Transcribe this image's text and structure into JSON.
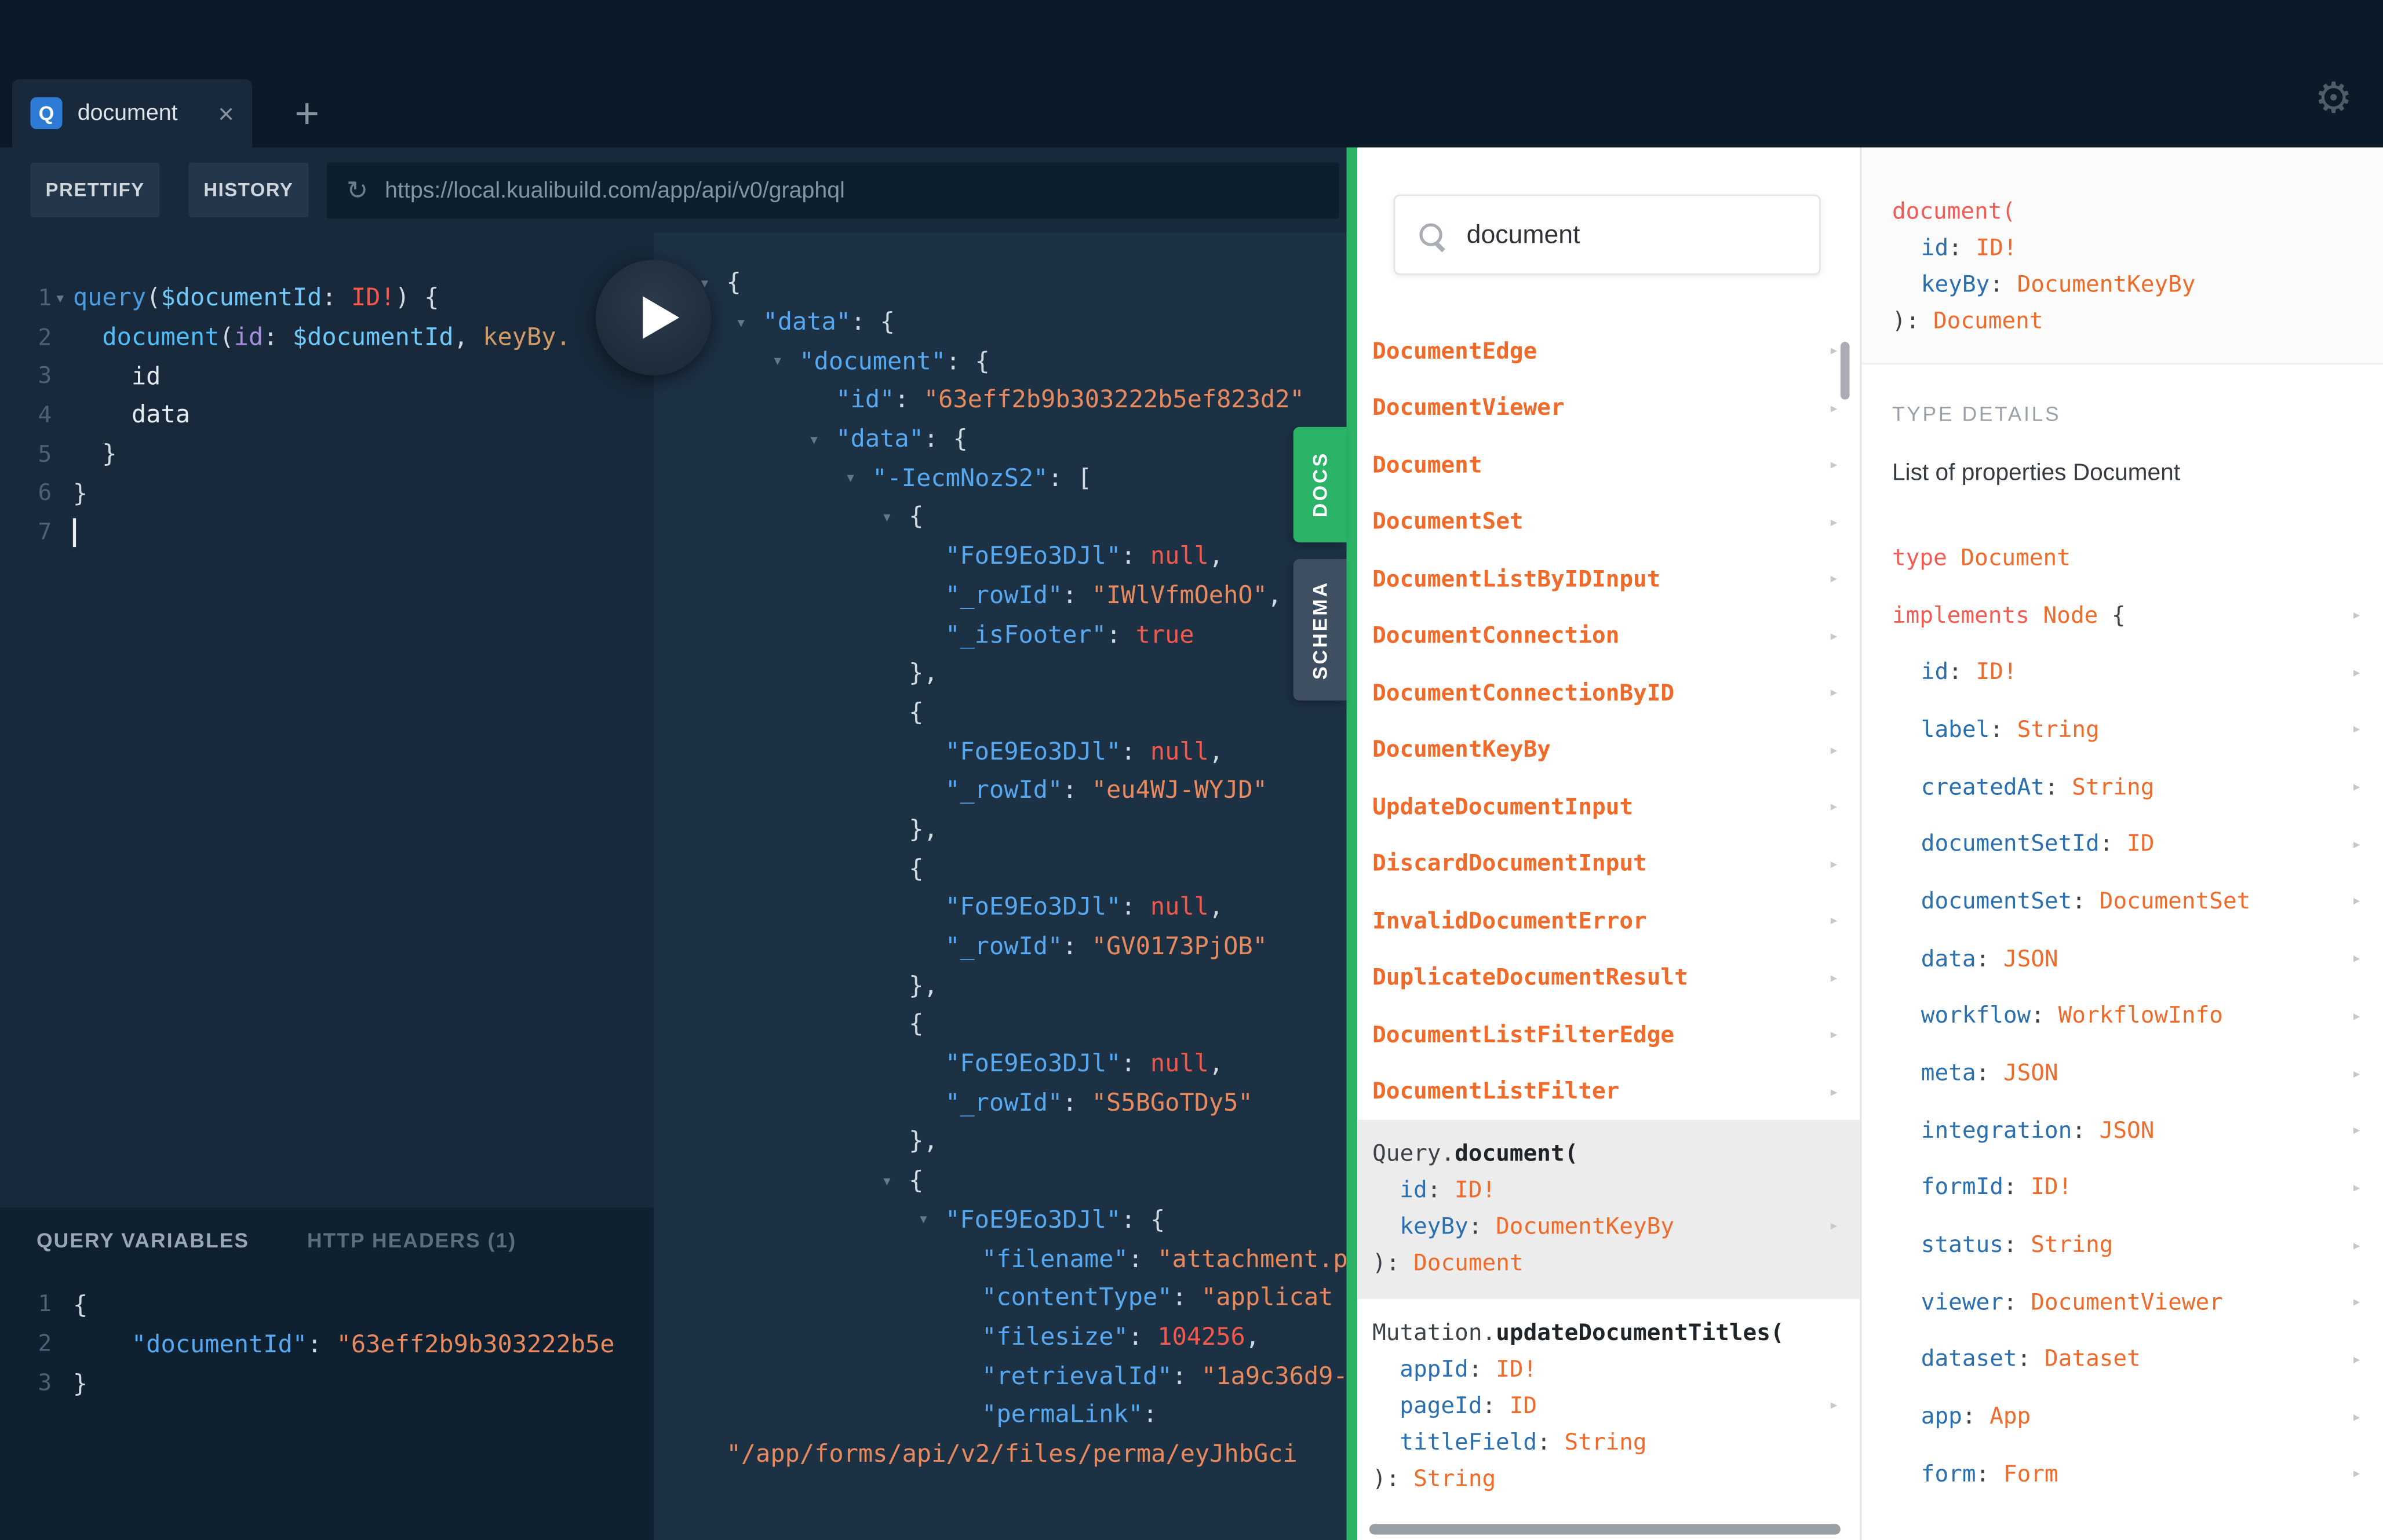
{
  "colors": {
    "header_bg": "#0b1a28",
    "panel_bg": "#17293a",
    "results_bg": "#1d3145",
    "variables_bg": "#0f2130",
    "accent_green": "#2bb368",
    "docs_orange": "#f06a2a",
    "docs_red": "#f25c54",
    "docs_blue": "#2a6fb0"
  },
  "icons": {
    "tab_badge": "Q",
    "close": "×",
    "plus": "+",
    "gear": "⚙",
    "reload": "↻",
    "fold_open": "▾",
    "chevron": "▸",
    "search": "magnifier-css-shape",
    "play": "triangle-css-shape"
  },
  "tab_bar": {
    "tab_title": "document"
  },
  "toolbar": {
    "prettify": "PRETTIFY",
    "history": "HISTORY",
    "url": "https://local.kualibuild.com/app/api/v0/graphql"
  },
  "query_editor": {
    "lines": [
      {
        "no": "1",
        "fold": true,
        "segments": [
          {
            "t": "query",
            "c": "kw"
          },
          {
            "t": "(",
            "c": "p"
          },
          {
            "t": "$documentId",
            "c": "var"
          },
          {
            "t": ": ",
            "c": "p"
          },
          {
            "t": "ID!",
            "c": "typ"
          },
          {
            "t": ") {",
            "c": "p"
          }
        ]
      },
      {
        "no": "2",
        "segments": [
          {
            "t": "  ",
            "c": "p"
          },
          {
            "t": "document",
            "c": "fld"
          },
          {
            "t": "(",
            "c": "p"
          },
          {
            "t": "id",
            "c": "arg"
          },
          {
            "t": ": ",
            "c": "p"
          },
          {
            "t": "$documentId",
            "c": "var"
          },
          {
            "t": ", ",
            "c": "p"
          },
          {
            "t": "keyBy.",
            "c": "argo"
          }
        ]
      },
      {
        "no": "3",
        "segments": [
          {
            "t": "    id",
            "c": "sel"
          }
        ]
      },
      {
        "no": "4",
        "segments": [
          {
            "t": "    data",
            "c": "sel"
          }
        ]
      },
      {
        "no": "5",
        "segments": [
          {
            "t": "  }",
            "c": "p"
          }
        ]
      },
      {
        "no": "6",
        "segments": [
          {
            "t": "}",
            "c": "p"
          }
        ]
      },
      {
        "no": "7",
        "cursor": true,
        "segments": []
      }
    ]
  },
  "results": {
    "lines": [
      {
        "ind": 0,
        "fold": true,
        "segments": [
          {
            "t": "{",
            "c": "p"
          }
        ]
      },
      {
        "ind": 1,
        "fold": true,
        "segments": [
          {
            "t": "\"data\"",
            "c": "k"
          },
          {
            "t": ": {",
            "c": "p"
          }
        ]
      },
      {
        "ind": 2,
        "fold": true,
        "segments": [
          {
            "t": "\"document\"",
            "c": "k"
          },
          {
            "t": ": {",
            "c": "p"
          }
        ]
      },
      {
        "ind": 3,
        "segments": [
          {
            "t": "\"id\"",
            "c": "k"
          },
          {
            "t": ": ",
            "c": "p"
          },
          {
            "t": "\"63eff2b9b303222b5ef823d2\"",
            "c": "s"
          }
        ]
      },
      {
        "ind": 3,
        "fold": true,
        "segments": [
          {
            "t": "\"data\"",
            "c": "k"
          },
          {
            "t": ": {",
            "c": "p"
          }
        ]
      },
      {
        "ind": 4,
        "fold": true,
        "segments": [
          {
            "t": "\"-IecmNozS2\"",
            "c": "k"
          },
          {
            "t": ": [",
            "c": "p"
          }
        ]
      },
      {
        "ind": 5,
        "fold": true,
        "segments": [
          {
            "t": "{",
            "c": "p"
          }
        ]
      },
      {
        "ind": 6,
        "segments": [
          {
            "t": "\"FoE9Eo3DJl\"",
            "c": "k"
          },
          {
            "t": ": ",
            "c": "p"
          },
          {
            "t": "null",
            "c": "v"
          },
          {
            "t": ",",
            "c": "p"
          }
        ]
      },
      {
        "ind": 6,
        "segments": [
          {
            "t": "\"_rowId\"",
            "c": "k"
          },
          {
            "t": ": ",
            "c": "p"
          },
          {
            "t": "\"IWlVfmOehO\"",
            "c": "s"
          },
          {
            "t": ",",
            "c": "p"
          }
        ]
      },
      {
        "ind": 6,
        "segments": [
          {
            "t": "\"_isFooter\"",
            "c": "k"
          },
          {
            "t": ": ",
            "c": "p"
          },
          {
            "t": "true",
            "c": "v"
          }
        ]
      },
      {
        "ind": 5,
        "segments": [
          {
            "t": "},",
            "c": "p"
          }
        ]
      },
      {
        "ind": 5,
        "segments": [
          {
            "t": "{",
            "c": "p"
          }
        ]
      },
      {
        "ind": 6,
        "segments": [
          {
            "t": "\"FoE9Eo3DJl\"",
            "c": "k"
          },
          {
            "t": ": ",
            "c": "p"
          },
          {
            "t": "null",
            "c": "v"
          },
          {
            "t": ",",
            "c": "p"
          }
        ]
      },
      {
        "ind": 6,
        "segments": [
          {
            "t": "\"_rowId\"",
            "c": "k"
          },
          {
            "t": ": ",
            "c": "p"
          },
          {
            "t": "\"eu4WJ-WYJD\"",
            "c": "s"
          }
        ]
      },
      {
        "ind": 5,
        "segments": [
          {
            "t": "},",
            "c": "p"
          }
        ]
      },
      {
        "ind": 5,
        "segments": [
          {
            "t": "{",
            "c": "p"
          }
        ]
      },
      {
        "ind": 6,
        "segments": [
          {
            "t": "\"FoE9Eo3DJl\"",
            "c": "k"
          },
          {
            "t": ": ",
            "c": "p"
          },
          {
            "t": "null",
            "c": "v"
          },
          {
            "t": ",",
            "c": "p"
          }
        ]
      },
      {
        "ind": 6,
        "segments": [
          {
            "t": "\"_rowId\"",
            "c": "k"
          },
          {
            "t": ": ",
            "c": "p"
          },
          {
            "t": "\"GV0173PjOB\"",
            "c": "s"
          }
        ]
      },
      {
        "ind": 5,
        "segments": [
          {
            "t": "},",
            "c": "p"
          }
        ]
      },
      {
        "ind": 5,
        "segments": [
          {
            "t": "{",
            "c": "p"
          }
        ]
      },
      {
        "ind": 6,
        "segments": [
          {
            "t": "\"FoE9Eo3DJl\"",
            "c": "k"
          },
          {
            "t": ": ",
            "c": "p"
          },
          {
            "t": "null",
            "c": "v"
          },
          {
            "t": ",",
            "c": "p"
          }
        ]
      },
      {
        "ind": 6,
        "segments": [
          {
            "t": "\"_rowId\"",
            "c": "k"
          },
          {
            "t": ": ",
            "c": "p"
          },
          {
            "t": "\"S5BGoTDy5\"",
            "c": "s"
          }
        ]
      },
      {
        "ind": 5,
        "segments": [
          {
            "t": "},",
            "c": "p"
          }
        ]
      },
      {
        "ind": 5,
        "fold": true,
        "segments": [
          {
            "t": "{",
            "c": "p"
          }
        ]
      },
      {
        "ind": 6,
        "fold": true,
        "segments": [
          {
            "t": "\"FoE9Eo3DJl\"",
            "c": "k"
          },
          {
            "t": ": {",
            "c": "p"
          }
        ]
      },
      {
        "ind": 7,
        "segments": [
          {
            "t": "\"filename\"",
            "c": "k"
          },
          {
            "t": ": ",
            "c": "p"
          },
          {
            "t": "\"attachment.p",
            "c": "s"
          }
        ]
      },
      {
        "ind": 7,
        "segments": [
          {
            "t": "\"contentType\"",
            "c": "k"
          },
          {
            "t": ": ",
            "c": "p"
          },
          {
            "t": "\"applicat",
            "c": "s"
          }
        ]
      },
      {
        "ind": 7,
        "segments": [
          {
            "t": "\"filesize\"",
            "c": "k"
          },
          {
            "t": ": ",
            "c": "p"
          },
          {
            "t": "104256",
            "c": "v"
          },
          {
            "t": ",",
            "c": "p"
          }
        ]
      },
      {
        "ind": 7,
        "segments": [
          {
            "t": "\"retrievalId\"",
            "c": "k"
          },
          {
            "t": ": ",
            "c": "p"
          },
          {
            "t": "\"1a9c36d9-",
            "c": "s"
          }
        ]
      },
      {
        "ind": 7,
        "segments": [
          {
            "t": "\"permaLink\"",
            "c": "k"
          },
          {
            "t": ":",
            "c": "p"
          }
        ]
      },
      {
        "ind": 0,
        "segments": [
          {
            "t": "\"/app/forms/api/v2/files/perma/eyJhbGci",
            "c": "s"
          }
        ]
      }
    ]
  },
  "variables": {
    "tab_query_variables": "QUERY VARIABLES",
    "tab_http_headers": "HTTP HEADERS (1)",
    "lines": [
      {
        "no": "1",
        "segments": [
          {
            "t": "{",
            "c": "p"
          }
        ]
      },
      {
        "no": "2",
        "segments": [
          {
            "t": "    ",
            "c": "p"
          },
          {
            "t": "\"documentId\"",
            "c": "k"
          },
          {
            "t": ": ",
            "c": "p"
          },
          {
            "t": "\"63eff2b9b303222b5e",
            "c": "s"
          }
        ]
      },
      {
        "no": "3",
        "segments": [
          {
            "t": "}",
            "c": "p"
          }
        ]
      }
    ]
  },
  "side_tabs": {
    "docs": "DOCS",
    "schema": "SCHEMA"
  },
  "docs": {
    "search_value": "document",
    "items": [
      "DocumentEdge",
      "DocumentViewer",
      "Document",
      "DocumentSet",
      "DocumentListByIDInput",
      "DocumentConnection",
      "DocumentConnectionByID",
      "DocumentKeyBy",
      "UpdateDocumentInput",
      "DiscardDocumentInput",
      "InvalidDocumentError",
      "DuplicateDocumentResult",
      "DocumentListFilterEdge",
      "DocumentListFilter"
    ],
    "entries": [
      {
        "highlighted": true,
        "lines": [
          {
            "segments": [
              {
                "t": "Query.",
                "c": "d"
              },
              {
                "t": "document(",
                "c": "db"
              }
            ]
          },
          {
            "ind": true,
            "segments": [
              {
                "t": "id",
                "c": "b"
              },
              {
                "t": ": ",
                "c": "d"
              },
              {
                "t": "ID!",
                "c": "o"
              }
            ]
          },
          {
            "ind": true,
            "chevron": true,
            "segments": [
              {
                "t": "keyBy",
                "c": "b"
              },
              {
                "t": ": ",
                "c": "d"
              },
              {
                "t": "DocumentKeyBy",
                "c": "o"
              }
            ]
          },
          {
            "segments": [
              {
                "t": "): ",
                "c": "d"
              },
              {
                "t": "Document",
                "c": "o"
              }
            ]
          }
        ]
      },
      {
        "highlighted": false,
        "lines": [
          {
            "segments": [
              {
                "t": "Mutation.",
                "c": "d"
              },
              {
                "t": "updateDocumentTitles(",
                "c": "db"
              }
            ]
          },
          {
            "ind": true,
            "segments": [
              {
                "t": "appId",
                "c": "b"
              },
              {
                "t": ": ",
                "c": "d"
              },
              {
                "t": "ID!",
                "c": "o"
              }
            ]
          },
          {
            "ind": true,
            "chevron": true,
            "segments": [
              {
                "t": "pageId",
                "c": "b"
              },
              {
                "t": ": ",
                "c": "d"
              },
              {
                "t": "ID",
                "c": "o"
              }
            ]
          },
          {
            "ind": true,
            "segments": [
              {
                "t": "titleField",
                "c": "b"
              },
              {
                "t": ": ",
                "c": "d"
              },
              {
                "t": "String",
                "c": "o"
              }
            ]
          },
          {
            "segments": [
              {
                "t": "): ",
                "c": "d"
              },
              {
                "t": "String",
                "c": "o"
              }
            ]
          }
        ]
      }
    ]
  },
  "detail": {
    "signature": [
      {
        "segments": [
          {
            "t": "document(",
            "c": "r"
          }
        ]
      },
      {
        "ind": true,
        "segments": [
          {
            "t": "id",
            "c": "b"
          },
          {
            "t": ": ",
            "c": "d"
          },
          {
            "t": "ID!",
            "c": "o"
          }
        ]
      },
      {
        "ind": true,
        "segments": [
          {
            "t": "keyBy",
            "c": "b"
          },
          {
            "t": ": ",
            "c": "d"
          },
          {
            "t": "DocumentKeyBy",
            "c": "o"
          }
        ]
      },
      {
        "segments": [
          {
            "t": "): ",
            "c": "d"
          },
          {
            "t": "Document",
            "c": "o"
          }
        ]
      }
    ],
    "section_label": "TYPE DETAILS",
    "properties_label": "List of properties Document",
    "type_line": [
      {
        "t": "type ",
        "c": "r"
      },
      {
        "t": "Document",
        "c": "o"
      }
    ],
    "implements_line": [
      {
        "t": "implements ",
        "c": "r"
      },
      {
        "t": "Node",
        "c": "o"
      },
      {
        "t": " {",
        "c": "d"
      }
    ],
    "fields": [
      {
        "name": "id",
        "type": "ID!"
      },
      {
        "name": "label",
        "type": "String"
      },
      {
        "name": "createdAt",
        "type": "String"
      },
      {
        "name": "documentSetId",
        "type": "ID"
      },
      {
        "name": "documentSet",
        "type": "DocumentSet"
      },
      {
        "name": "data",
        "type": "JSON"
      },
      {
        "name": "workflow",
        "type": "WorkflowInfo"
      },
      {
        "name": "meta",
        "type": "JSON"
      },
      {
        "name": "integration",
        "type": "JSON"
      },
      {
        "name": "formId",
        "type": "ID!"
      },
      {
        "name": "status",
        "type": "String"
      },
      {
        "name": "viewer",
        "type": "DocumentViewer"
      },
      {
        "name": "dataset",
        "type": "Dataset"
      },
      {
        "name": "app",
        "type": "App"
      },
      {
        "name": "form",
        "type": "Form"
      }
    ]
  }
}
